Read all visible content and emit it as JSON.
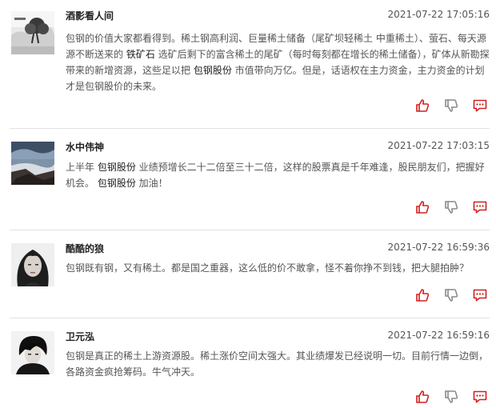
{
  "posts": [
    {
      "user": "酒影看人间",
      "time": "2021-07-22 17:05:16",
      "avatar": "ink-landscape-avatar",
      "body": [
        {
          "t": "包钢的价值大家都看得到。稀土钢高利润、巨量稀土储备（尾矿坝轻稀土 中重稀土）、萤石、每天源源不断送来的 "
        },
        {
          "t": "铁矿石",
          "link": true
        },
        {
          "t": " 选矿后剩下的富含稀土的尾矿（每时每刻都在增长的稀土储备），矿体从新勘探带来的新增资源，这些足以把 "
        },
        {
          "t": "包钢股份",
          "link": true
        },
        {
          "t": " 市值带向万亿。但是，话语权在主力资金，主力资金的计划才是包钢股价的未来。"
        }
      ]
    },
    {
      "user": "水中伟神",
      "time": "2021-07-22 17:03:15",
      "avatar": "seascape-avatar",
      "body": [
        {
          "t": "上半年 "
        },
        {
          "t": "包钢股份",
          "link": true
        },
        {
          "t": " 业绩预增长二十二倍至三十二倍，这样的股票真是千年难逢，股民朋友们，把握好机会。 "
        },
        {
          "t": "包钢股份",
          "link": true
        },
        {
          "t": " 加油！"
        }
      ]
    },
    {
      "user": "酷酷的狼",
      "time": "2021-07-22 16:59:36",
      "avatar": "woman-portrait-avatar",
      "body": [
        {
          "t": "包钢既有钢，又有稀土。都是国之重器，这么低的价不敢拿，怪不着你挣不到钱，把大腿拍肿？"
        }
      ]
    },
    {
      "user": "卫元泓",
      "time": "2021-07-22 16:59:16",
      "avatar": "man-portrait-avatar",
      "body": [
        {
          "t": "包钢是真正的稀土上游资源股。稀土涨价空间太强大。其业绩爆发已经说明一切。目前行情一边倒，各路资金疯抢筹码。牛气冲天。"
        }
      ]
    }
  ],
  "actions": {
    "like_icon": "thumbs-up-icon",
    "dislike_icon": "thumbs-down-icon",
    "reply_icon": "comment-icon"
  },
  "colors": {
    "like": "#d32020",
    "dislike": "#8a8a8a",
    "reply": "#d32020",
    "divider": "#e2e2e2"
  }
}
